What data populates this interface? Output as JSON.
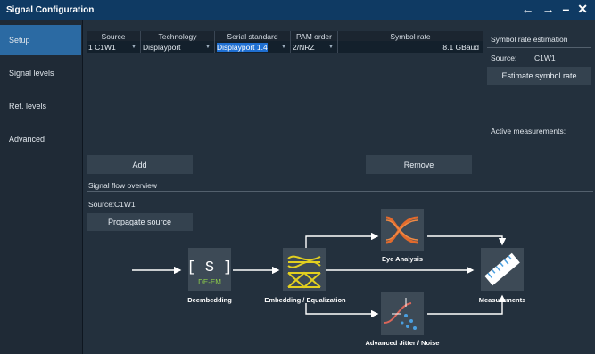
{
  "window": {
    "title": "Signal Configuration",
    "controls": [
      "←",
      "→",
      "–",
      "✕"
    ]
  },
  "sidebar": {
    "items": [
      {
        "label": "Setup",
        "active": true
      },
      {
        "label": "Signal levels",
        "active": false
      },
      {
        "label": "Ref. levels",
        "active": false
      },
      {
        "label": "Advanced",
        "active": false
      }
    ]
  },
  "table": {
    "headers": [
      "Source",
      "Technology",
      "Serial standard",
      "PAM order",
      "Symbol rate"
    ],
    "rows": [
      {
        "index": "1",
        "source": "C1W1",
        "technology": "Displayport",
        "serial_standard": "Displayport 1.4",
        "pam_order": "2/NRZ",
        "symbol_rate": "8.1 GBaud"
      }
    ]
  },
  "estimation": {
    "title": "Symbol rate estimation",
    "source_label": "Source:",
    "source_value": "C1W1",
    "button": "Estimate symbol rate",
    "active_measurements_label": "Active measurements:"
  },
  "actions": {
    "add": "Add",
    "remove": "Remove"
  },
  "flow": {
    "title": "Signal flow overview",
    "source_label": "Source:",
    "source_value": "C1W1",
    "propagate_button": "Propagate source",
    "blocks": {
      "deembedding": {
        "label": "Deembedding",
        "icon_text": "[ S ]",
        "sub_text": "DE-EM"
      },
      "equalization": {
        "label": "Embedding / Equalization"
      },
      "eye": {
        "label": "Eye Analysis"
      },
      "jitter": {
        "label": "Advanced Jitter / Noise"
      },
      "measurements": {
        "label": "Measurements"
      }
    }
  },
  "colors": {
    "titlebar": "#0f3a63",
    "active_tab": "#2b6aa3",
    "selection": "#1f6fd1",
    "eq_yellow": "#e3d01f",
    "eye_orange": "#e26a2c",
    "deemb_green": "#8fd14a",
    "meas_blue": "#4a9fe0"
  }
}
